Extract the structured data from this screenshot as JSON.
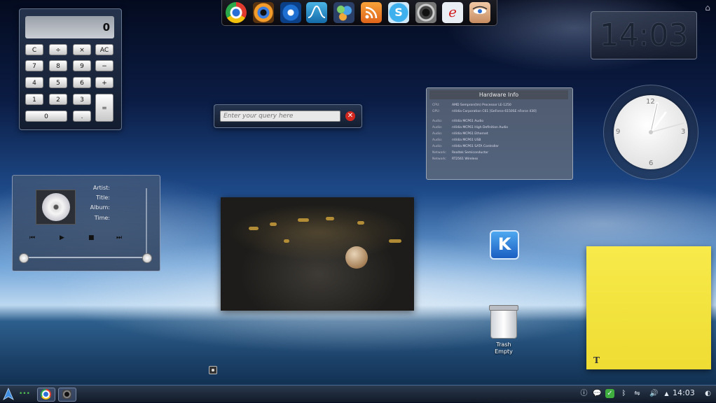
{
  "calculator": {
    "display": "0",
    "keys": {
      "c": "C",
      "div": "÷",
      "mul": "×",
      "ac": "AC",
      "k7": "7",
      "k8": "8",
      "k9": "9",
      "minus": "−",
      "k4": "4",
      "k5": "5",
      "k6": "6",
      "plus": "+",
      "k1": "1",
      "k2": "2",
      "k3": "3",
      "eq": "=",
      "k0": "0",
      "dot": "."
    }
  },
  "dock": {
    "icons": [
      "chrome-icon",
      "eye-icon",
      "settings-icon",
      "wave-icon",
      "messenger-icon",
      "rss-icon",
      "skype-icon",
      "camera-icon",
      "edit-icon",
      "face-icon"
    ]
  },
  "digital_clock": {
    "time": "14:03"
  },
  "search": {
    "placeholder": "Enter your query here"
  },
  "hardware_info": {
    "title": "Hardware Info",
    "rows": [
      {
        "k": "CPU:",
        "v": "AMD Sempron(tm) Processor LE-1250"
      },
      {
        "k": "GPU:",
        "v": "nVidia Corporation C61 [GeForce 6150SE nForce 430]"
      },
      {
        "k": "Audio:",
        "v": "nVidia MCP61 Audio"
      },
      {
        "k": "Audio:",
        "v": "nVidia MCP61 High Definition Audio"
      },
      {
        "k": "Audio:",
        "v": "nVidia MCP61 Ethernet"
      },
      {
        "k": "Audio:",
        "v": "nVidia MCP61 USB"
      },
      {
        "k": "Audio:",
        "v": "nVidia MCP61 SATA Controller"
      },
      {
        "k": "Network:",
        "v": "Realtek Semiconductor"
      },
      {
        "k": "Network:",
        "v": "RT2561 Wireless"
      }
    ]
  },
  "analog_clock": {
    "n12": "12",
    "n3": "3",
    "n6": "6",
    "n9": "9"
  },
  "media_player": {
    "artist_label": "Artist:",
    "title_label": "Title:",
    "album_label": "Album:",
    "time_label": "Time:",
    "prev": "⏮",
    "play": "▶",
    "stop": "■",
    "next": "⏭"
  },
  "desktop_icons": {
    "kde": "K",
    "trash": "Trash",
    "trash_status": "Empty"
  },
  "sticky_note": {
    "tool": "T"
  },
  "panel": {
    "time": "14:03"
  },
  "colors": {
    "panel": "#1b2638",
    "note": "#f2e13e",
    "accent": "#4fa8f0"
  }
}
